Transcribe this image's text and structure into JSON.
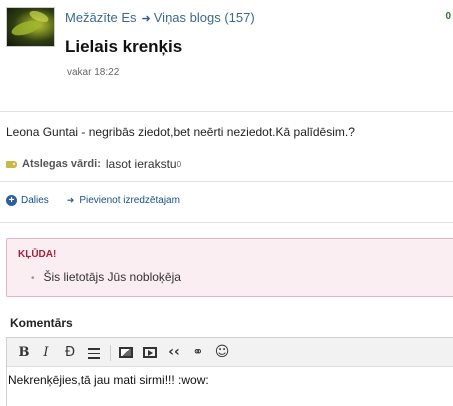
{
  "author": {
    "name": "Mežāzīte Es",
    "blog_link": "Viņas blogs (157)",
    "corner_value": "0"
  },
  "post": {
    "title": "Lielais krenķis",
    "time": "vakar 18:22",
    "body": "Leona Guntai - negribās ziedot,bet neērti  neziedot.Kā palīdēsim.?"
  },
  "keywords": {
    "label": "Atslegas vārdi:",
    "value": "lasot ierakstu",
    "count": "0"
  },
  "actions": {
    "share": "Dalies",
    "add_favorite": "Pievienot izredzētajam"
  },
  "error": {
    "title": "KĻŪDA!",
    "message": "Šis lietotājs Jūs nobloķēja"
  },
  "comment": {
    "label": "Komentārs",
    "text": "Nekrenķējies,tā jau mati sirmi!!!  :wow:"
  },
  "toolbar": {
    "bold": "B",
    "italic": "I",
    "strike": "Ð",
    "quote": "‹‹"
  },
  "icons": {
    "avatar": "user-avatar",
    "tag": "tag-icon",
    "share": "share-plus-icon",
    "arrow": "arrow-right-icon"
  }
}
